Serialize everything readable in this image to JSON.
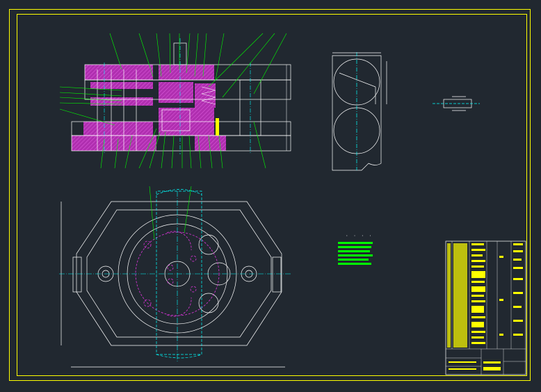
{
  "drawing": {
    "background": "#212830",
    "colors": {
      "frame": "#ffff00",
      "outline": "#ffffff",
      "leader": "#00ff00",
      "hatch": "#cc33cc",
      "centerline": "#00ffff",
      "title_fill": "#ffff00"
    },
    "views": [
      "assembly-section-view",
      "plan-view",
      "part-detail-view",
      "small-part-view"
    ],
    "tech_requirements_marker": "· · · ·"
  }
}
